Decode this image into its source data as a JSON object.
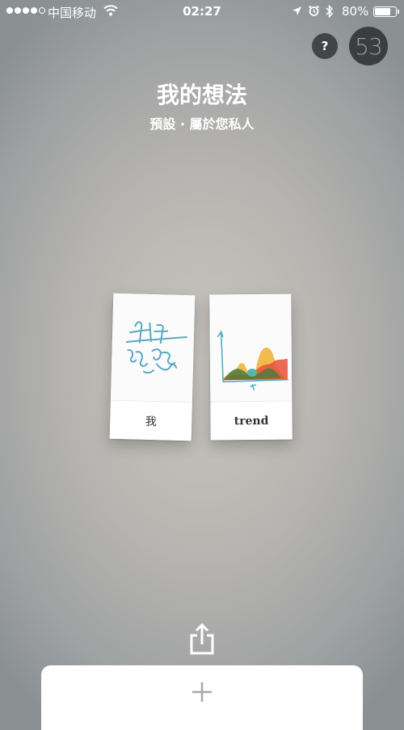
{
  "status_bar": {
    "carrier": "中国移动",
    "time": "02:27",
    "battery_percent": "80%",
    "battery_level": 0.8,
    "signal_bars_filled": 4,
    "signal_bars_total": 5
  },
  "header": {
    "help_label": "?",
    "app_logo": "53",
    "title": "我的想法",
    "subtitle": "預設 · 屬於您私人"
  },
  "ideas": {
    "cards": [
      {
        "label": "我",
        "icon": "handwriting-sketch-icon"
      },
      {
        "label": "trend",
        "icon": "area-chart-sketch-icon"
      }
    ]
  },
  "toolbar": {
    "share_icon": "share-icon",
    "add_icon": "plus-icon"
  },
  "colors": {
    "handwriting": "#5aa9c0",
    "chart_yellow": "#f0b53c",
    "chart_red": "#e8503a",
    "chart_green": "#4f7a3c",
    "chart_teal": "#55b7a8"
  }
}
